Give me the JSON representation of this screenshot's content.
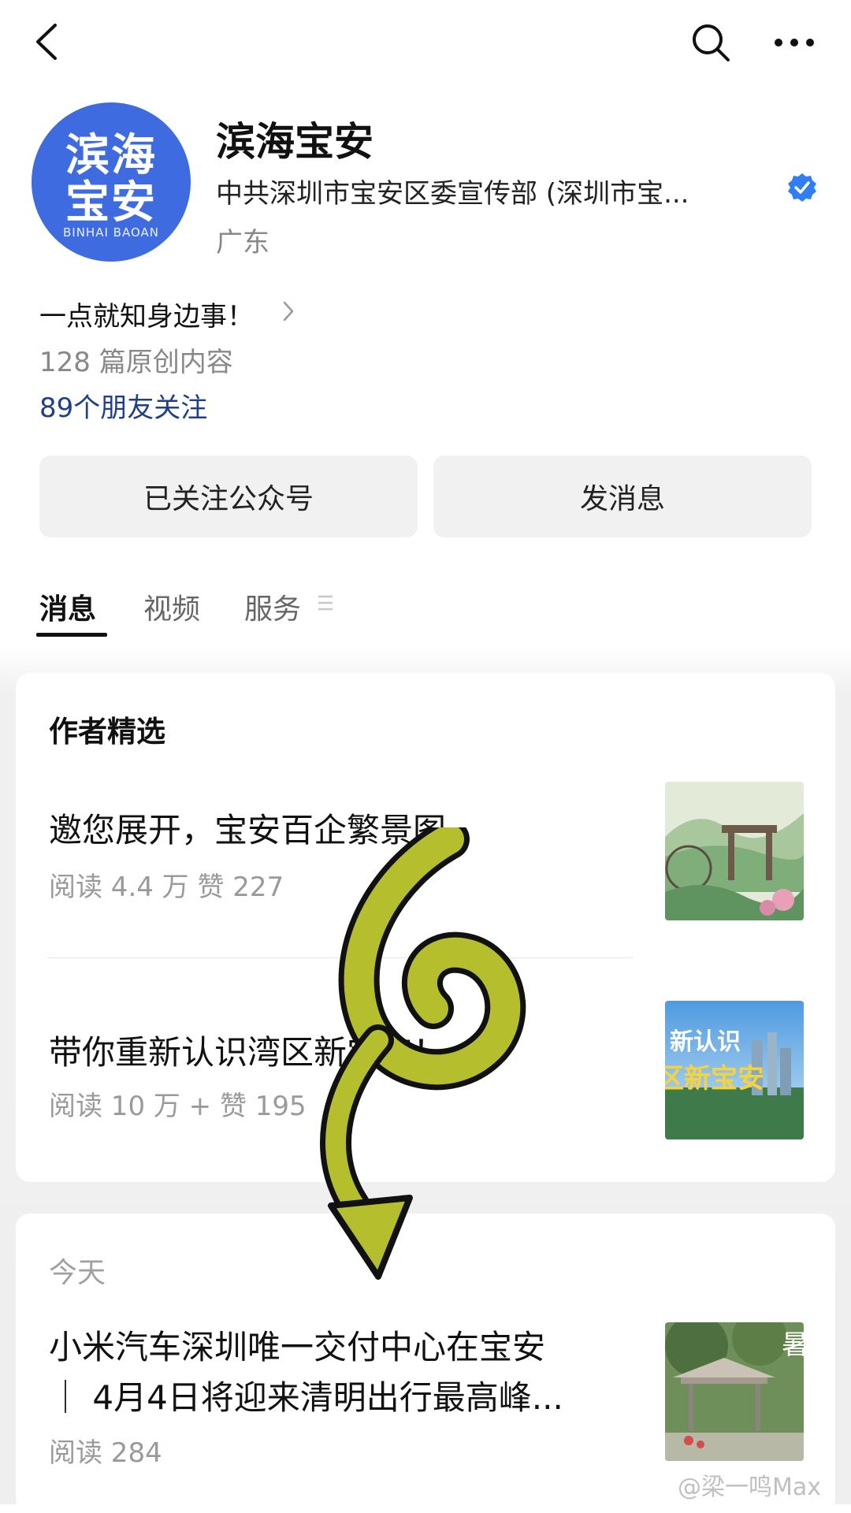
{
  "header": {
    "back_icon": "back-chevron-icon",
    "search_icon": "search-icon",
    "more_icon": "more-dots-icon"
  },
  "account": {
    "avatar_line1": "滨海",
    "avatar_line2": "宝安",
    "avatar_pinyin": "BINHAI  BAOAN",
    "name": "滨海宝安",
    "org": "中共深圳市宝安区委宣传部 (深圳市宝...",
    "location": "广东",
    "slogan": "一点就知身边事！",
    "original_count": "128 篇原创内容",
    "friends_follow": "89个朋友关注",
    "verified_color": "#2f7ef6"
  },
  "actions": {
    "followed": "已关注公众号",
    "message": "发消息"
  },
  "tabs": [
    {
      "label": "消息",
      "active": true
    },
    {
      "label": "视频",
      "active": false
    },
    {
      "label": "服务",
      "active": false
    }
  ],
  "featured": {
    "title": "作者精选",
    "articles": [
      {
        "title": "邀您展开，宝安百企繁景图",
        "meta": "阅读 4.4 万   赞 227"
      },
      {
        "title": "带你重新认识湾区新宝安！",
        "meta": "阅读 10 万 +   赞 195"
      }
    ]
  },
  "today": {
    "label": "今天",
    "article": {
      "title_line1": "小米汽车深圳唯一交付中心在宝安",
      "title_line2": "｜ 4月4日将迎来清明出行最高峰...",
      "meta": "阅读 284"
    }
  },
  "thumb2_text": {
    "line1": "新认识",
    "line2": "区新宝安"
  },
  "thumb3_text": "暑",
  "watermark": "@梁一鸣Max",
  "overlay_glyph": "6",
  "colors": {
    "accent_blue": "#3f6be0",
    "link_blue": "#1f3f86",
    "overlay_green": "#b5bf2e"
  }
}
